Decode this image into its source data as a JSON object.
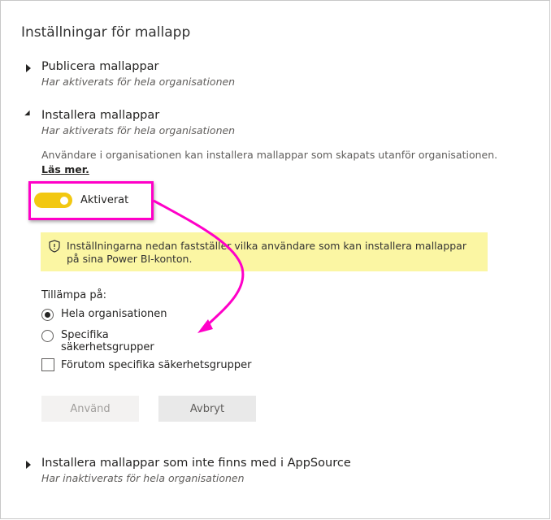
{
  "title": "Inställningar för mallapp",
  "sections": [
    {
      "title": "Publicera mallappar",
      "subtitle": "Har aktiverats för hela organisationen",
      "expanded": false
    },
    {
      "title": "Installera mallappar",
      "subtitle": "Har aktiverats för hela organisationen",
      "expanded": true,
      "description": "Användare i organisationen kan installera mallappar som skapats utanför organisationen.",
      "learn_more": "Läs mer.",
      "toggle": {
        "label": "Aktiverat",
        "on": true
      },
      "banner": {
        "icon": "shield-warning-icon",
        "line1": "Inställningarna nedan fastställer vilka användare som kan installera mallappar",
        "line2": "på sina Power BI-konton."
      },
      "apply_to": {
        "label": "Tillämpa på:",
        "options": [
          "Hela organisationen",
          "Specifika säkerhetsgrupper"
        ],
        "selected": 0
      },
      "except": {
        "label": "Förutom specifika säkerhetsgrupper",
        "checked": false
      },
      "buttons": {
        "apply": "Använd",
        "cancel": "Avbryt"
      }
    },
    {
      "title": "Installera mallappar som inte finns med i AppSource",
      "subtitle": "Har inaktiverats för hela organisationen",
      "expanded": false
    }
  ],
  "colors": {
    "toggle": "#f2c811",
    "highlight": "#ff00c8",
    "banner": "#fbf6a3"
  }
}
